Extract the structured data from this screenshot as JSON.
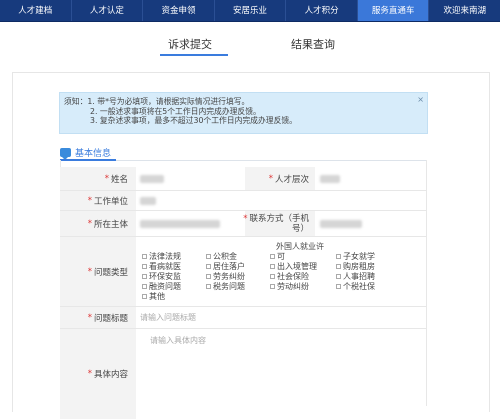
{
  "topnav": {
    "items": [
      "人才建档",
      "人才认定",
      "资金申领",
      "安居乐业",
      "人才积分",
      "服务直通车",
      "欢迎来南湖"
    ],
    "active_index": 5,
    "active_color": "#3b78d9",
    "bg_color": "#173a7d"
  },
  "tabs": {
    "items": [
      "诉求提交",
      "结果查询"
    ],
    "active_index": 0
  },
  "notice": {
    "lines": [
      "须知：1. 带*号为必填项，请根据实际情况进行填写。",
      "2. 一般述求事项将在5个工作日内完成办理反馈。",
      "3. 复杂述求事项，最多不超过30个工作日内完成办理反馈。"
    ],
    "close": "×"
  },
  "section": {
    "title": "基本信息"
  },
  "form": {
    "required_mark": "*",
    "name_label": "姓名",
    "talent_level_label": "人才层次",
    "work_unit_label": "工作单位",
    "subject_label": "所在主体",
    "contact_label_line1": "联系方式（手机",
    "contact_label_line2": "号）",
    "issue_type_label": "问题类型",
    "issue_type_options": [
      "法律法规",
      "公积金",
      "外国人就业许可",
      "子女就学",
      "看病就医",
      "居住落户",
      "出入境管理",
      "购房租房",
      "环保安监",
      "劳务纠纷",
      "社会保险",
      "人事招聘",
      "融资问题",
      "税务问题",
      "劳动纠纷",
      "个税社保",
      "其他"
    ],
    "issue_title_label": "问题标题",
    "issue_title_placeholder": "请输入问题标题",
    "content_label": "具体内容",
    "content_placeholder": "请输入具体内容"
  }
}
